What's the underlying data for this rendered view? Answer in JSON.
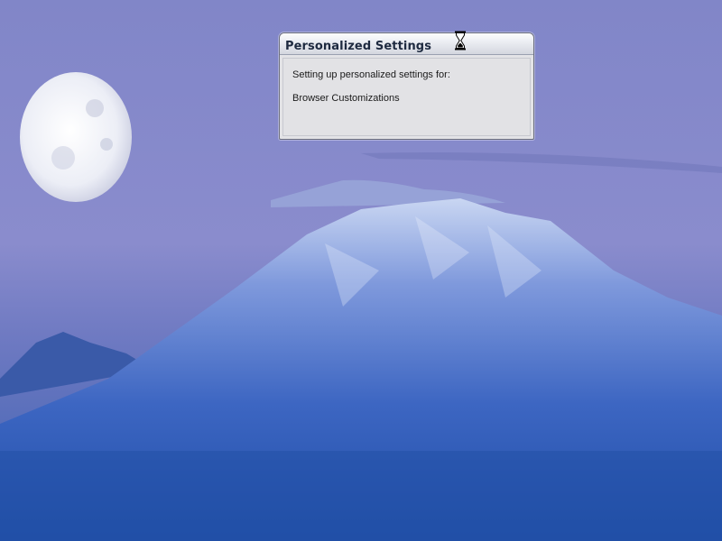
{
  "dialog": {
    "title": "Personalized Settings",
    "message": "Setting up personalized settings for:",
    "component": "Browser Customizations"
  },
  "desktop": {
    "wallpaper_icon": "mountain-moon-wallpaper",
    "cursor_icon": "hourglass-icon"
  },
  "colors": {
    "sky": "#7f83c9",
    "dialog_bg": "#e2e2e5",
    "title_text": "#1e2a40"
  }
}
